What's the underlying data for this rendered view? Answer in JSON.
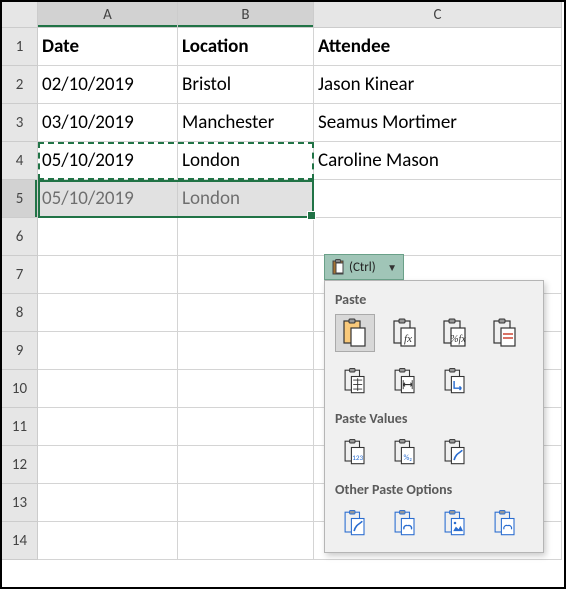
{
  "columns": [
    "A",
    "B",
    "C"
  ],
  "row_labels": [
    "1",
    "2",
    "3",
    "4",
    "5",
    "6",
    "7",
    "8",
    "9",
    "10",
    "11",
    "12",
    "13",
    "14"
  ],
  "headers": {
    "a": "Date",
    "b": "Location",
    "c": "Attendee"
  },
  "rows": [
    {
      "a": "02/10/2019",
      "b": "Bristol",
      "c": "Jason Kinear"
    },
    {
      "a": "03/10/2019",
      "b": "Manchester",
      "c": "Seamus Mortimer"
    },
    {
      "a": "05/10/2019",
      "b": "London",
      "c": "Caroline Mason"
    },
    {
      "a": "05/10/2019",
      "b": "London",
      "c": ""
    }
  ],
  "paste_button": {
    "label": "(Ctrl)"
  },
  "paste_panel": {
    "section1": "Paste",
    "section2": "Paste Values",
    "section3": "Other Paste Options"
  },
  "selection": {
    "copied": "A4:B4",
    "active": "A5:B5"
  },
  "chart_data": null
}
